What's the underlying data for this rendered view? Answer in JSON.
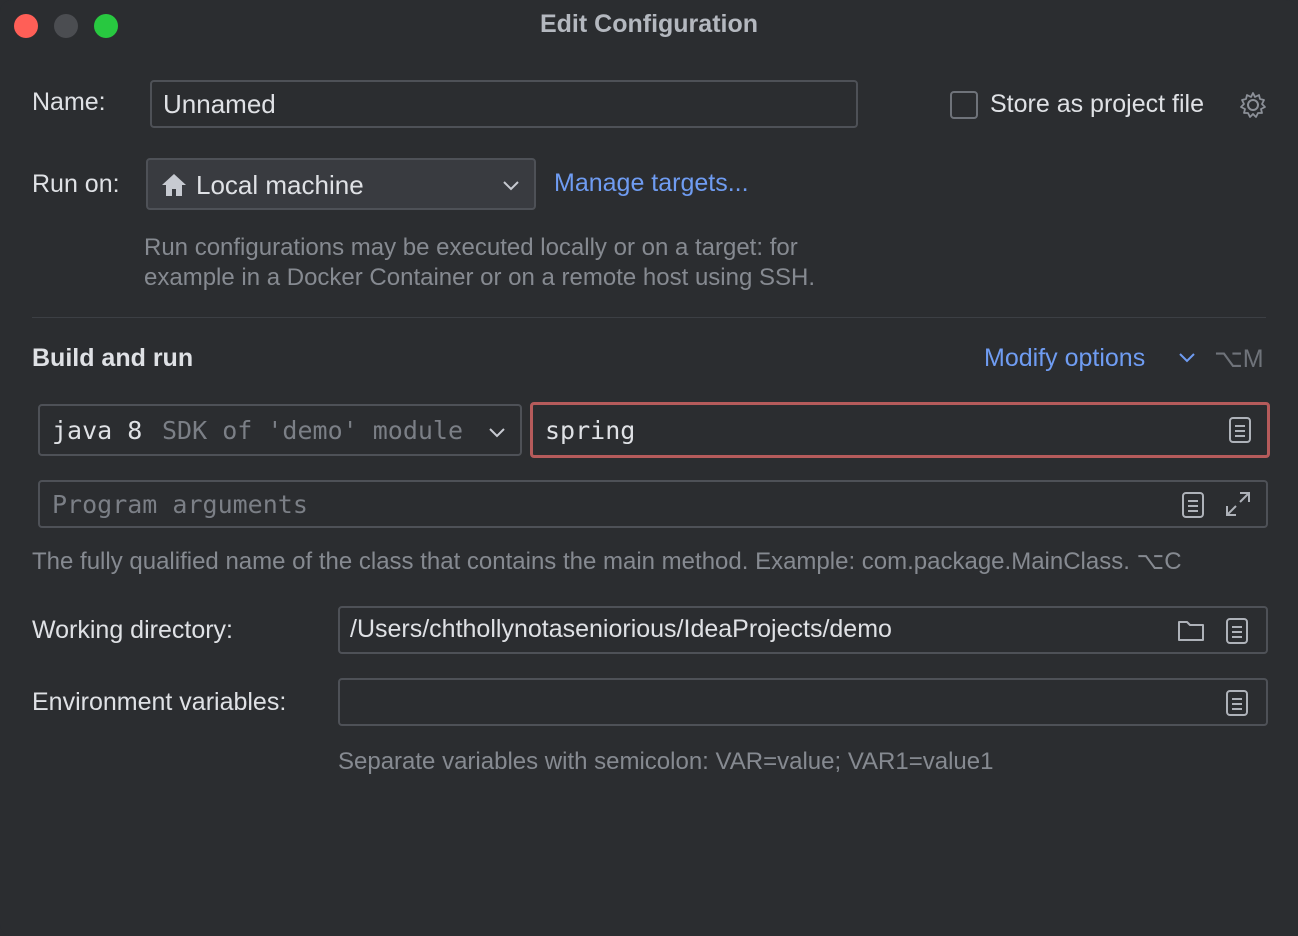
{
  "window": {
    "title": "Edit Configuration"
  },
  "name": {
    "label": "Name:",
    "value": "Unnamed"
  },
  "store_project": {
    "label": "Store as project file",
    "checked": false
  },
  "run_on": {
    "label": "Run on:",
    "selected": "Local machine",
    "manage_link": "Manage targets...",
    "hint_line1": "Run configurations may be executed locally or on a target: for",
    "hint_line2": "example in a Docker Container or on a remote host using SSH."
  },
  "build_run": {
    "title": "Build and run",
    "modify_options": "Modify options",
    "modify_shortcut": "⌥M",
    "sdk_name": "java 8",
    "sdk_detail": "SDK of 'demo' module",
    "main_class_value": "spring",
    "program_args_placeholder": "Program arguments",
    "main_class_hint": "The fully qualified name of the class that contains the main method. Example: com.package.MainClass. ⌥C"
  },
  "working_dir": {
    "label": "Working directory:",
    "value": "/Users/chthollynotaseniorious/IdeaProjects/demo"
  },
  "env_vars": {
    "label": "Environment variables:",
    "value": "",
    "hint": "Separate variables with semicolon: VAR=value; VAR1=value1"
  },
  "colors": {
    "background": "#2b2d30",
    "link": "#6f9cf2",
    "error_border": "#b55b5b"
  }
}
